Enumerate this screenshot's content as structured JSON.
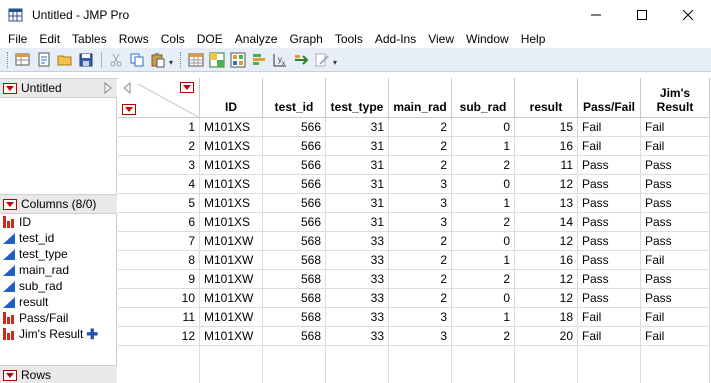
{
  "window": {
    "title": "Untitled - JMP Pro",
    "controls": [
      "minimize",
      "maximize",
      "close"
    ]
  },
  "menubar": [
    "File",
    "Edit",
    "Tables",
    "Rows",
    "Cols",
    "DOE",
    "Analyze",
    "Graph",
    "Tools",
    "Add-Ins",
    "View",
    "Window",
    "Help"
  ],
  "toolbar": {
    "icons": [
      "new-data-table-icon",
      "new-script-icon",
      "open-icon",
      "save-icon",
      "cut-icon",
      "copy-icon",
      "paste-icon",
      "data-table-icon",
      "tabulate-icon",
      "graph-builder-icon",
      "distribution-icon",
      "fit-y-by-x-icon",
      "fit-model-icon",
      "script-edit-icon"
    ]
  },
  "left_panel": {
    "table_name": "Untitled",
    "columns_header": "Columns (8/0)",
    "columns": [
      {
        "name": "ID",
        "type": "nominal"
      },
      {
        "name": "test_id",
        "type": "continuous"
      },
      {
        "name": "test_type",
        "type": "continuous"
      },
      {
        "name": "main_rad",
        "type": "continuous"
      },
      {
        "name": "sub_rad",
        "type": "continuous"
      },
      {
        "name": "result",
        "type": "continuous"
      },
      {
        "name": "Pass/Fail",
        "type": "nominal"
      },
      {
        "name": "Jim's Result",
        "type": "nominal"
      }
    ],
    "rows_header": "Rows"
  },
  "table": {
    "headers": [
      "ID",
      "test_id",
      "test_type",
      "main_rad",
      "sub_rad",
      "result",
      "Pass/Fail",
      "Jim's Result"
    ],
    "header_lines": [
      [
        "ID"
      ],
      [
        "test_id"
      ],
      [
        "test_type"
      ],
      [
        "main_rad"
      ],
      [
        "sub_rad"
      ],
      [
        "result"
      ],
      [
        "Pass/Fail"
      ],
      [
        "Jim's",
        "Result"
      ]
    ],
    "rows": [
      [
        "1",
        "M101XS",
        "566",
        "31",
        "2",
        "0",
        "15",
        "Fail",
        "Fail"
      ],
      [
        "2",
        "M101XS",
        "566",
        "31",
        "2",
        "1",
        "16",
        "Fail",
        "Fail"
      ],
      [
        "3",
        "M101XS",
        "566",
        "31",
        "2",
        "2",
        "11",
        "Pass",
        "Pass"
      ],
      [
        "4",
        "M101XS",
        "566",
        "31",
        "3",
        "0",
        "12",
        "Pass",
        "Pass"
      ],
      [
        "5",
        "M101XS",
        "566",
        "31",
        "3",
        "1",
        "13",
        "Pass",
        "Pass"
      ],
      [
        "6",
        "M101XS",
        "566",
        "31",
        "3",
        "2",
        "14",
        "Pass",
        "Pass"
      ],
      [
        "7",
        "M101XW",
        "568",
        "33",
        "2",
        "0",
        "12",
        "Pass",
        "Pass"
      ],
      [
        "8",
        "M101XW",
        "568",
        "33",
        "2",
        "1",
        "16",
        "Pass",
        "Fail"
      ],
      [
        "9",
        "M101XW",
        "568",
        "33",
        "2",
        "2",
        "12",
        "Pass",
        "Pass"
      ],
      [
        "10",
        "M101XW",
        "568",
        "33",
        "2",
        "0",
        "12",
        "Pass",
        "Pass"
      ],
      [
        "11",
        "M101XW",
        "568",
        "33",
        "3",
        "1",
        "18",
        "Fail",
        "Fail"
      ],
      [
        "12",
        "M101XW",
        "568",
        "33",
        "3",
        "2",
        "20",
        "Fail",
        "Fail"
      ]
    ]
  },
  "colors": {
    "hot_spot_red": "#cc0000",
    "nominal_icon": "#cc2a1e",
    "continuous_icon": "#1f5fbf",
    "toolbar_bg": "#e8eef7"
  }
}
